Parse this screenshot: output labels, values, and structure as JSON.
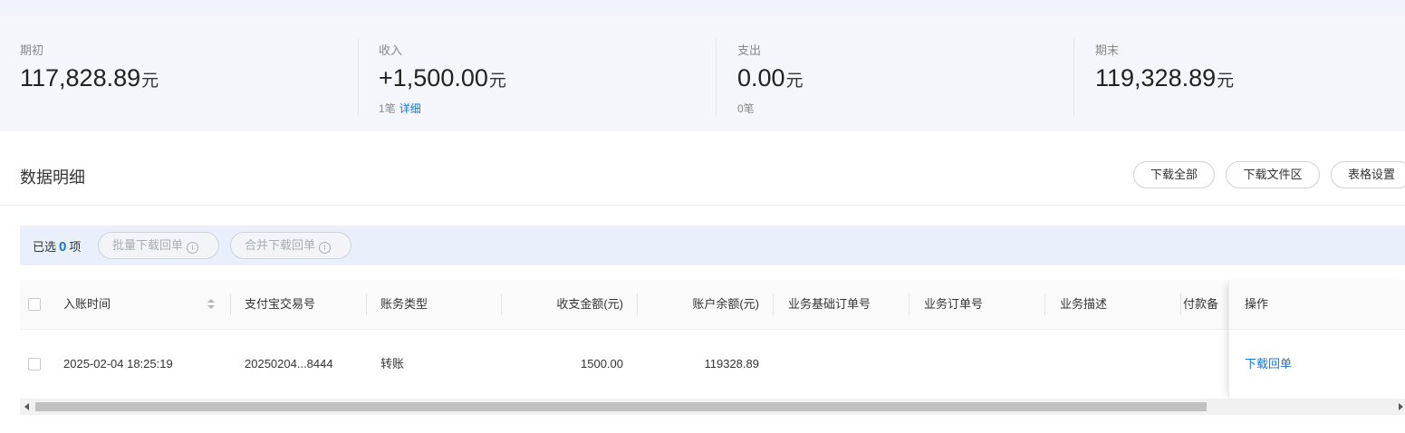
{
  "summary": {
    "opening": {
      "label": "期初",
      "value": "117,828.89",
      "unit": "元"
    },
    "income": {
      "label": "收入",
      "value": "+1,500.00",
      "unit": "元",
      "count": "1笔",
      "detail_link": "详细"
    },
    "expense": {
      "label": "支出",
      "value": "0.00",
      "unit": "元",
      "count": "0笔"
    },
    "closing": {
      "label": "期末",
      "value": "119,328.89",
      "unit": "元"
    }
  },
  "section": {
    "title": "数据明细",
    "buttons": {
      "download_all": "下载全部",
      "download_files": "下载文件区",
      "table_settings": "表格设置"
    }
  },
  "selection": {
    "prefix": "已选",
    "count": "0",
    "suffix": "项",
    "batch_download": "批量下载回单",
    "merge_download": "合并下载回单"
  },
  "table": {
    "columns": [
      "入账时间",
      "支付宝交易号",
      "账务类型",
      "收支金额(元)",
      "账户余额(元)",
      "业务基础订单号",
      "业务订单号",
      "业务描述",
      "付款备",
      "操作"
    ],
    "rows": [
      {
        "time": "2025-02-04 18:25:19",
        "trade_no": "20250204...8444",
        "type": "转账",
        "amount": "1500.00",
        "balance": "119328.89",
        "base_order": "",
        "order": "",
        "desc": "",
        "remark": "",
        "action": "下载回单"
      }
    ]
  },
  "colors": {
    "accent": "#1677d4",
    "summary_bg": "#f4f6fb",
    "selection_bg": "#e9f0fb"
  }
}
